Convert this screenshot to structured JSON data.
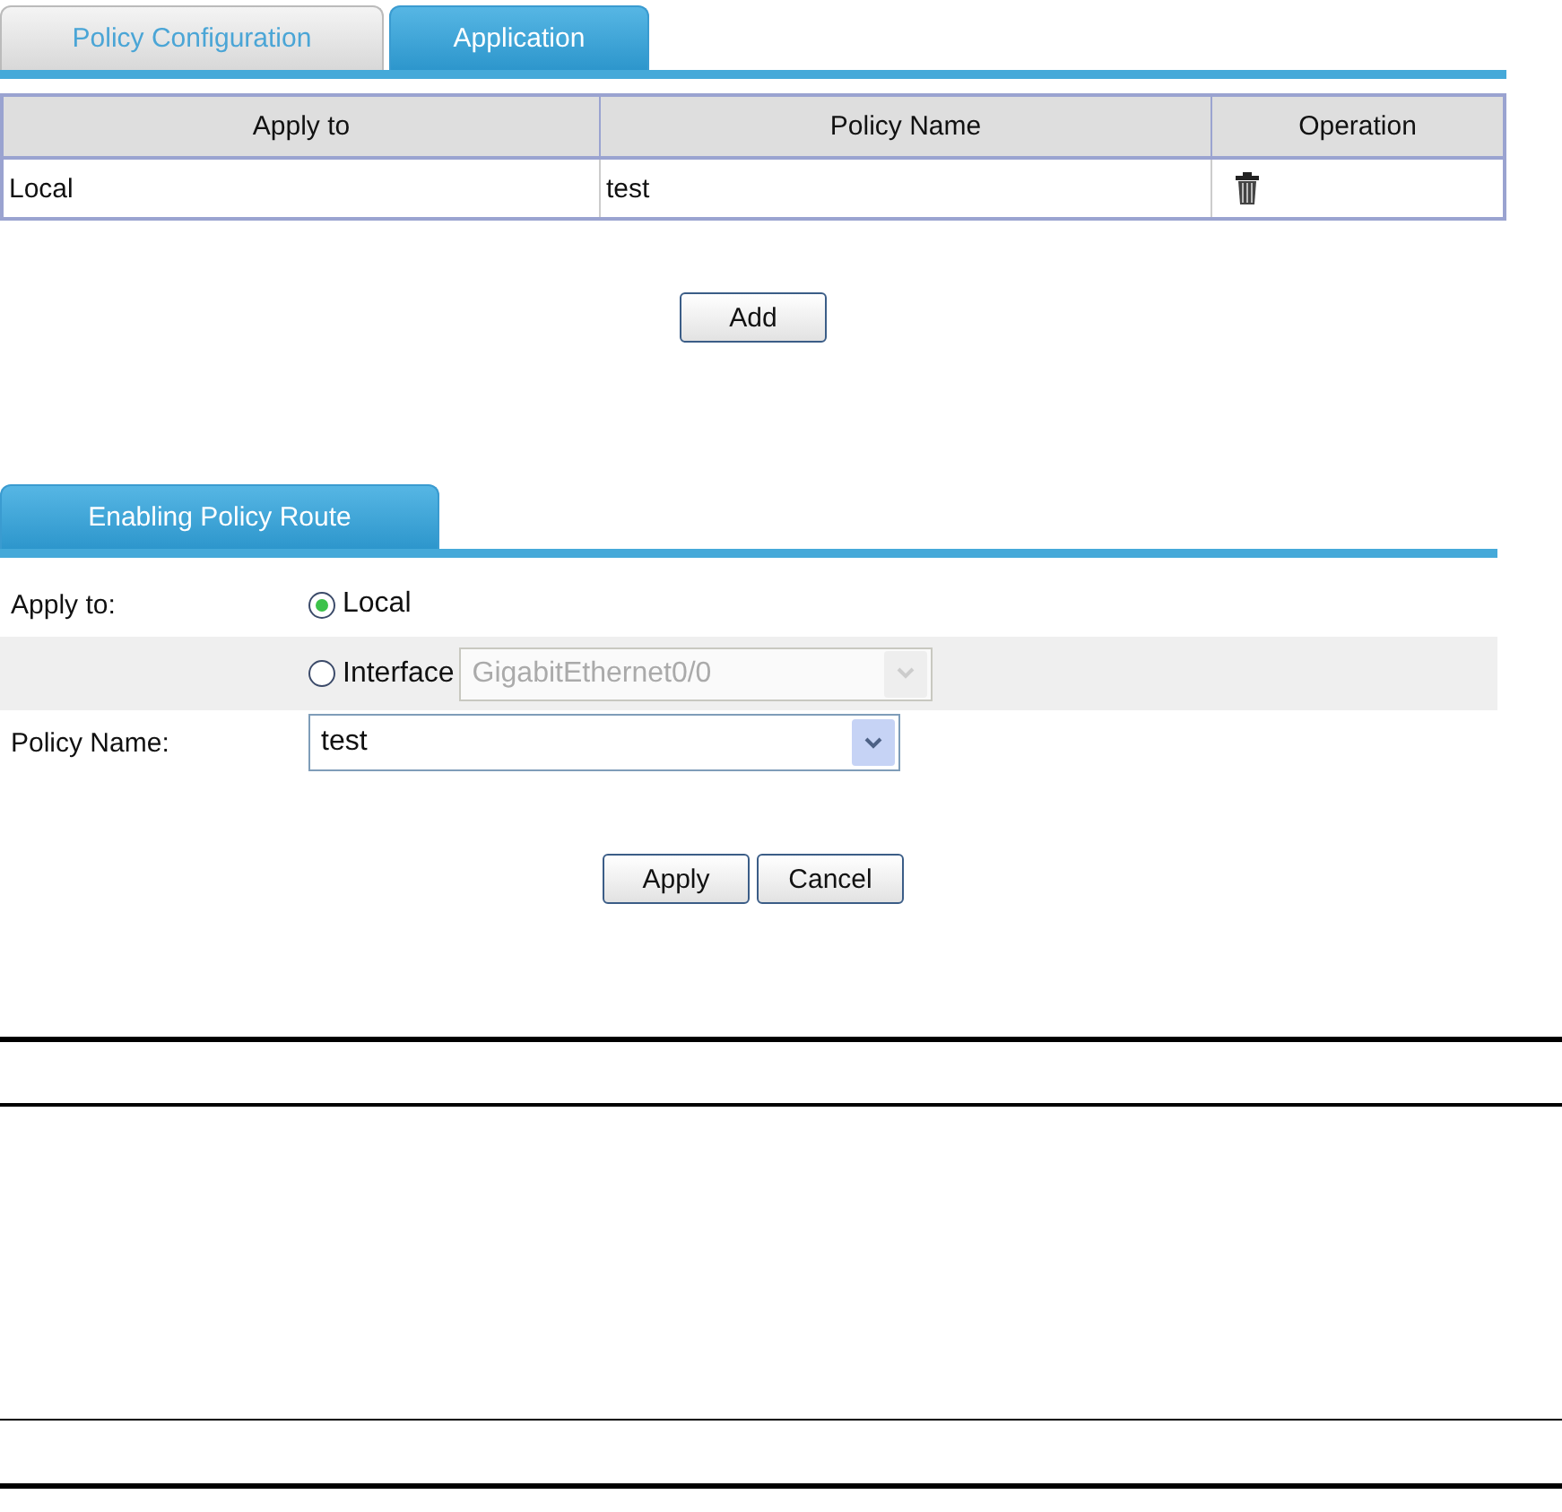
{
  "tabs": [
    {
      "label": "Policy Configuration",
      "selected": false
    },
    {
      "label": "Application",
      "selected": true
    }
  ],
  "table": {
    "columns": [
      "Apply to",
      "Policy Name",
      "Operation"
    ],
    "rows": [
      {
        "apply_to": "Local",
        "policy_name": "test"
      }
    ]
  },
  "add_button": "Add",
  "form": {
    "tab": "Enabling Policy Route",
    "apply_to_label": "Apply to:",
    "options": [
      {
        "label": "Local",
        "selected": true
      },
      {
        "label": "Interface",
        "selected": false,
        "select": {
          "value": "GigabitEthernet0/0",
          "disabled": true
        }
      }
    ],
    "policy_name_label": "Policy Name:",
    "policy_name": {
      "value": "test",
      "disabled": false
    }
  },
  "buttons": [
    "Apply",
    "Cancel"
  ]
}
